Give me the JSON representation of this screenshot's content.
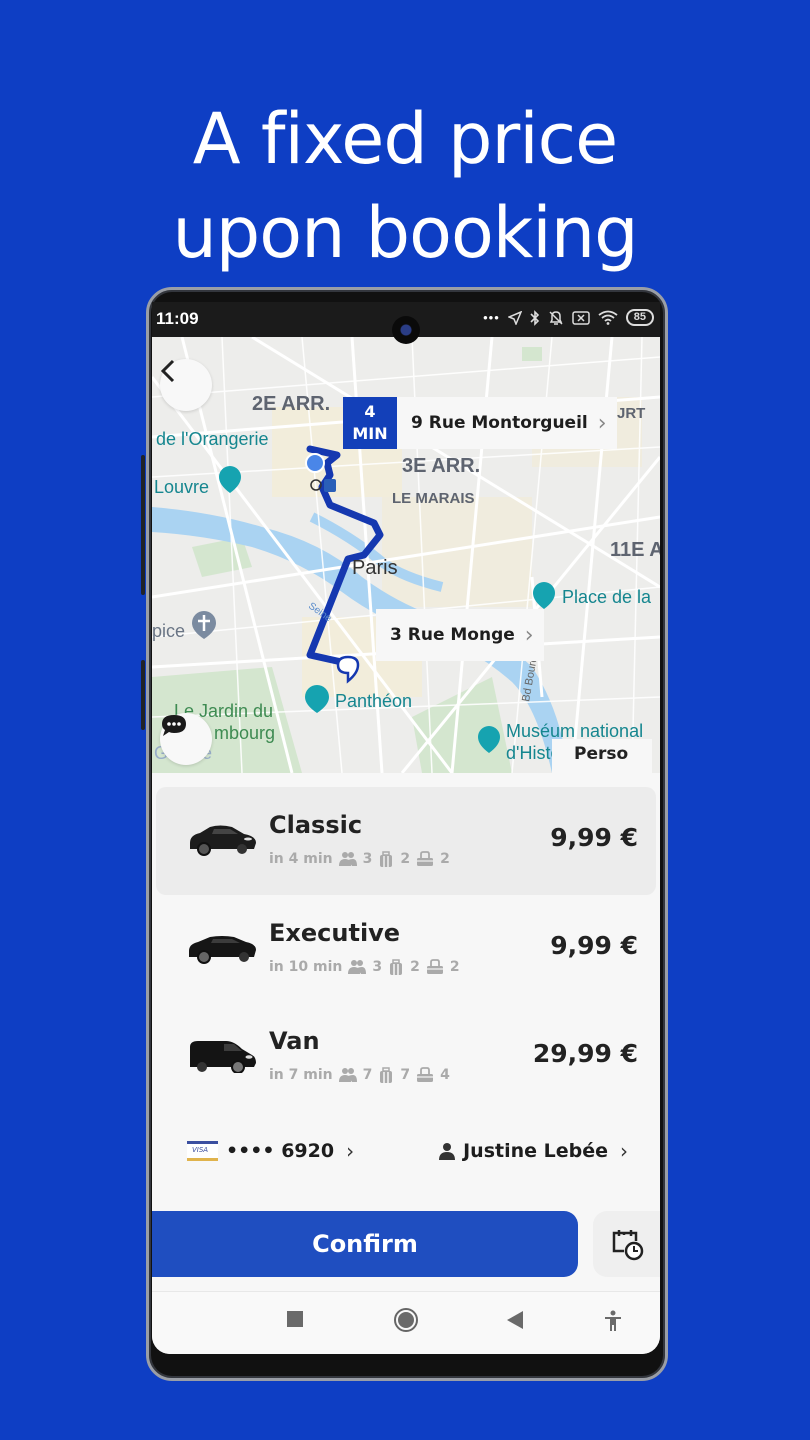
{
  "headline": {
    "line1": "A fixed price",
    "line2": "upon booking"
  },
  "colors": {
    "background": "#0e3ec4",
    "accent": "#1f4ec0",
    "eta_badge": "#1340b9",
    "route": "#1538b0"
  },
  "status_bar": {
    "time": "11:09",
    "icons": [
      "more-dots-icon",
      "location-arrow-icon",
      "bluetooth-icon",
      "bell-off-icon",
      "sim-x-icon",
      "wifi-icon",
      "battery-icon"
    ],
    "battery_level": "85"
  },
  "map": {
    "back_icon": "chevron-left-icon",
    "eta": {
      "value": "4",
      "unit": "MIN"
    },
    "pickup_address": "9 Rue Montorgueil",
    "dropoff_address": "3 Rue Monge",
    "labels": {
      "arr2": "2E ARR.",
      "arr3": "3E ARR.",
      "arr11": "11E A",
      "court": "JRT",
      "marais": "LE MARAIS",
      "orangerie": "de l'Orangerie",
      "louvre": "Louvre",
      "paris": "Paris",
      "place": "Place de la",
      "sulpice": "pice",
      "seine": "Seine",
      "pantheon": "Panthéon",
      "jardin1": "Le Jardin du",
      "jardin2": "mbourg",
      "museum1": "Muséum national",
      "museum2": "d'Histo",
      "bourdon": "Bd Bourdon",
      "google": "Google"
    },
    "chat_icon": "chat-bubble-icon",
    "category_tab": "Perso"
  },
  "rides": [
    {
      "name": "Classic",
      "eta": "in 4 min",
      "passengers": "3",
      "luggage": "2",
      "bags": "2",
      "price": "9,99 €",
      "selected": true,
      "icon": "sedan-car-icon"
    },
    {
      "name": "Executive",
      "eta": "in 10 min",
      "passengers": "3",
      "luggage": "2",
      "bags": "2",
      "price": "9,99 €",
      "selected": false,
      "icon": "executive-car-icon"
    },
    {
      "name": "Van",
      "eta": "in 7 min",
      "passengers": "7",
      "luggage": "7",
      "bags": "4",
      "price": "29,99 €",
      "selected": false,
      "icon": "van-icon"
    }
  ],
  "payment": {
    "card_brand": "VISA",
    "card_masked": "•••• 6920",
    "passenger_name": "Justine Lebée"
  },
  "actions": {
    "confirm_label": "Confirm",
    "schedule_icon": "calendar-clock-icon"
  },
  "navbar": {
    "items": [
      "recents-square-icon",
      "home-circle-icon",
      "back-triangle-icon",
      "accessibility-icon"
    ]
  }
}
